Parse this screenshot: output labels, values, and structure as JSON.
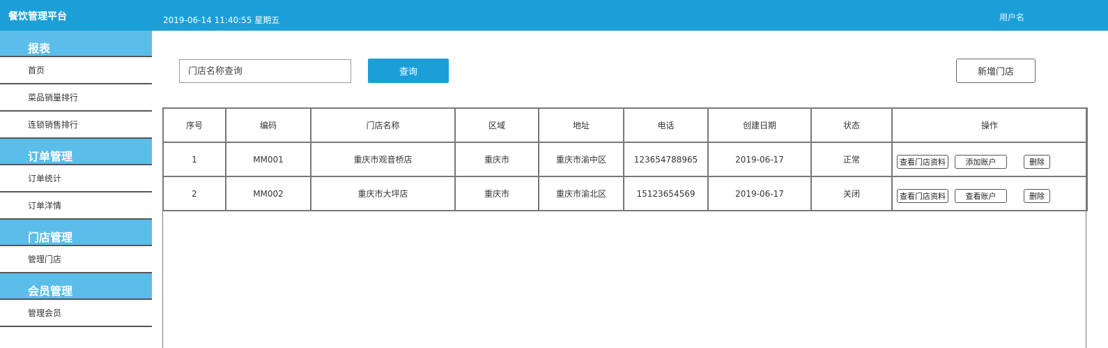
{
  "header": {
    "brand": "餐饮管理平台",
    "datetime": "2019-06-14 11:40:55 星期五",
    "username": "用户名"
  },
  "sidebar": {
    "sections": [
      {
        "title": "报表",
        "items": [
          "首页",
          "菜品销量排行",
          "连锁销售排行"
        ]
      },
      {
        "title": "订单管理",
        "items": [
          "订单统计",
          "订单洋情"
        ]
      },
      {
        "title": "门店管理",
        "items": [
          "管理门店"
        ]
      },
      {
        "title": "会员管理",
        "items": [
          "管理会员"
        ]
      }
    ]
  },
  "toolbar": {
    "search_placeholder": "门店名称查询",
    "search_button": "查询",
    "add_button": "新增门店"
  },
  "table": {
    "headers": [
      "序号",
      "编码",
      "门店名称",
      "区域",
      "地址",
      "电话",
      "创建日期",
      "状态",
      "操作"
    ],
    "rows": [
      {
        "no": "1",
        "code": "MM001",
        "name": "重庆市观音桥店",
        "region": "重庆市",
        "address": "重庆市渝中区",
        "phone": "123654788965",
        "date": "2019-06-17",
        "status": "正常",
        "actions": [
          "查看门店资料",
          "添加账户",
          "删除"
        ]
      },
      {
        "no": "2",
        "code": "MM002",
        "name": "重庆市大坪店",
        "region": "重庆市",
        "address": "重庆市渝北区",
        "phone": "15123654569",
        "date": "2019-06-17",
        "status": "关闭",
        "actions": [
          "查看门店资料",
          "查看账户",
          "删除"
        ]
      }
    ]
  },
  "colors": {
    "header_bg": "#1c9fd8",
    "sidebar_section_bg": "#5bbdea",
    "primary_button": "#1c9fd8"
  }
}
